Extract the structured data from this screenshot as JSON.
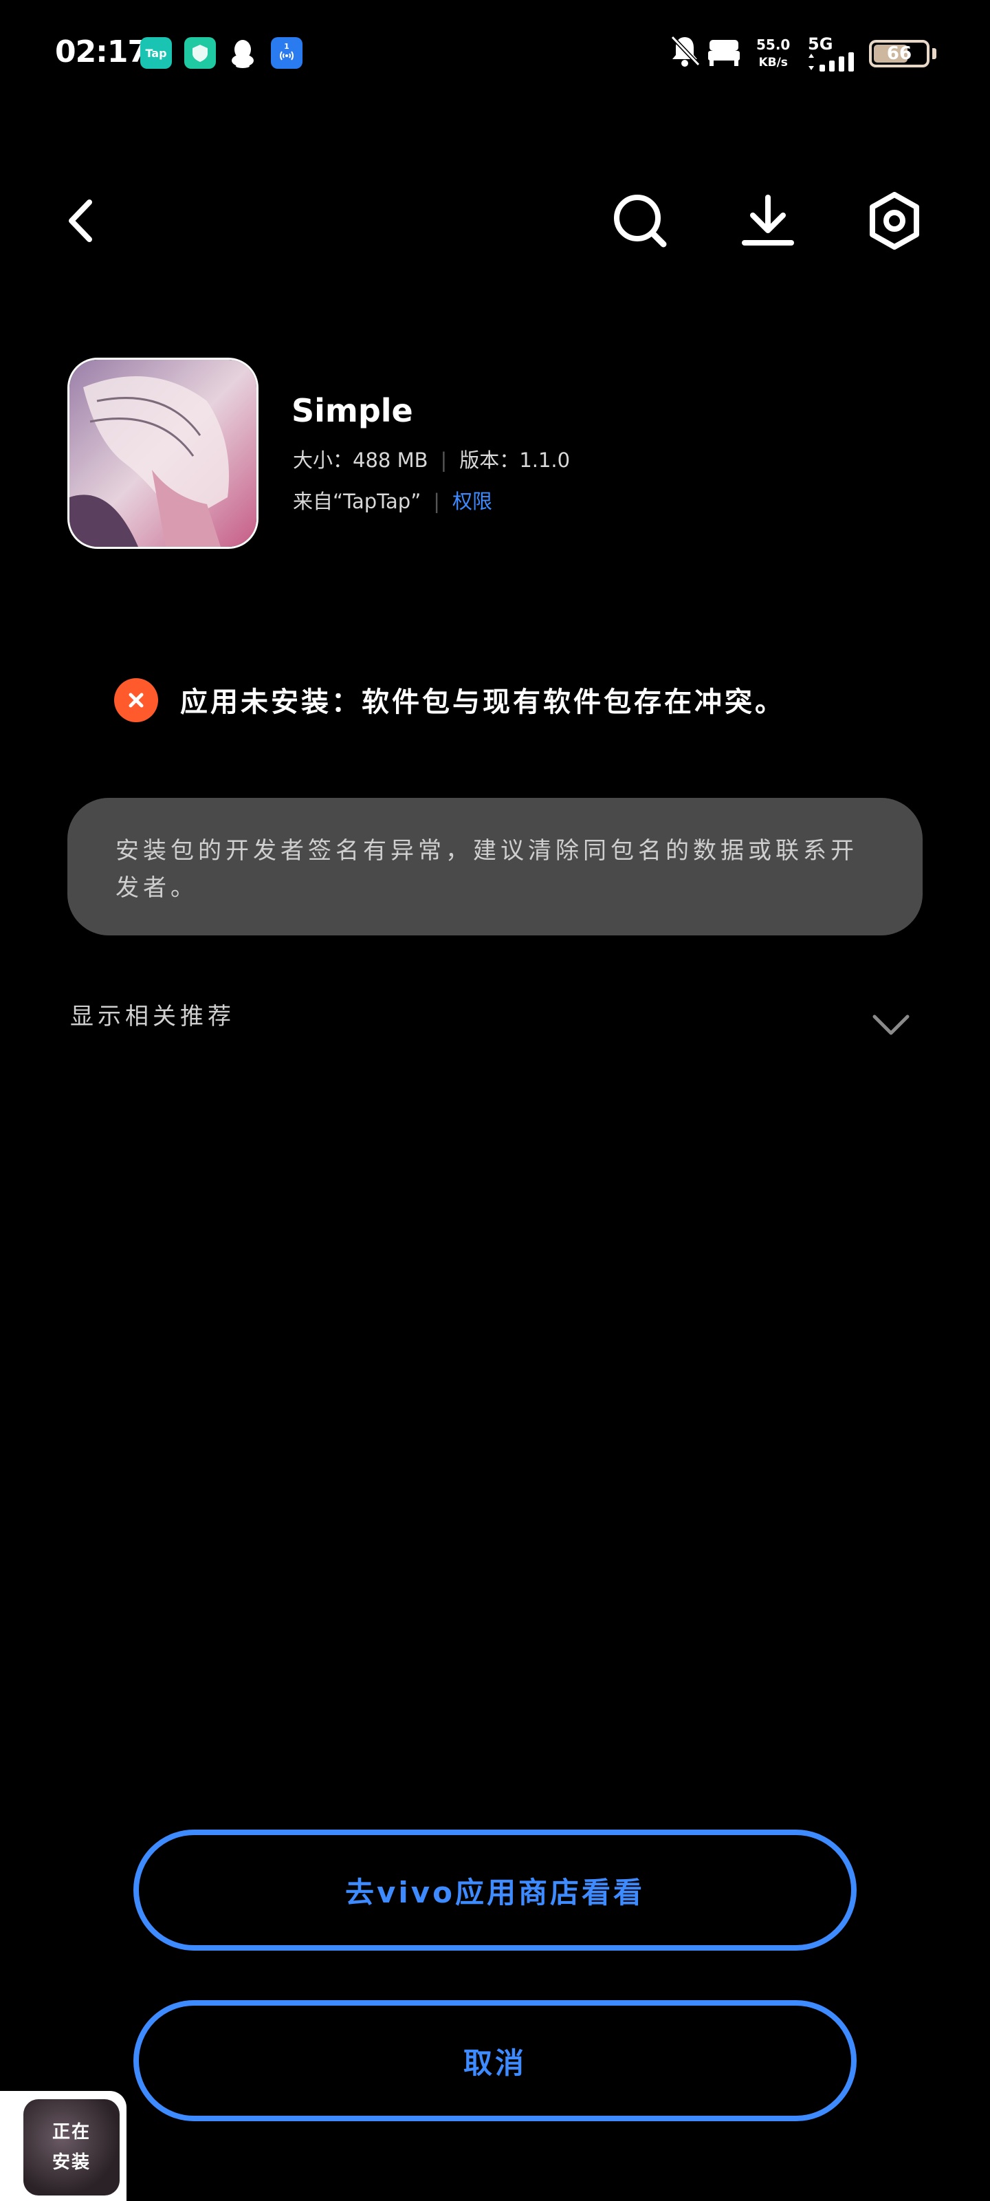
{
  "status_bar": {
    "time": "02:17",
    "apps": [
      {
        "name": "taptap-app-icon",
        "label": "Tap",
        "color": "#19c4b2"
      },
      {
        "name": "shield-app-icon",
        "label": "",
        "color": "#1fc9a2"
      },
      {
        "name": "qq-app-icon",
        "label": "",
        "color": "#000000"
      },
      {
        "name": "nfc-app-icon",
        "label": "1",
        "color": "#2a7bef"
      }
    ],
    "net_speed_value": "55.0",
    "net_speed_unit": "KB/s",
    "network": "5G",
    "battery": "66",
    "battery_level": 0.66
  },
  "app": {
    "name": "Simple",
    "size_label": "大小：",
    "size_value": "488 MB",
    "version_label": "版本：",
    "version_value": "1.1.0",
    "source": "来自“TapTap”",
    "permissions_link": "权限"
  },
  "error": {
    "message": "应用未安装：软件包与现有软件包存在冲突。"
  },
  "hint": {
    "text": "安装包的开发者签名有异常，建议清除同包名的数据或联系开发者。"
  },
  "recommend": {
    "label": "显示相关推荐"
  },
  "buttons": {
    "store": "去vivo应用商店看看",
    "cancel": "取消"
  },
  "floating": {
    "line1": "正在",
    "line2": "安装"
  },
  "colors": {
    "accent": "#3d8bff",
    "error": "#ff5a2c",
    "hint_bg": "#4a4a4a"
  }
}
